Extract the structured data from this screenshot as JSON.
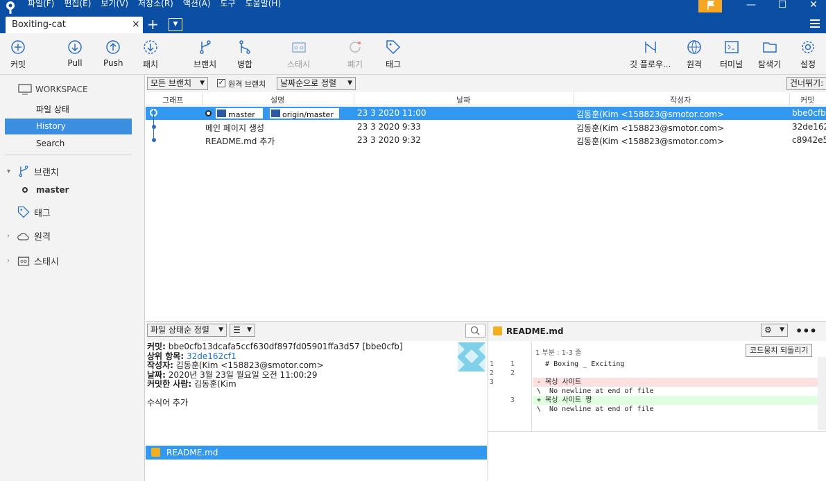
{
  "menu": [
    "파일(F)",
    "편집(E)",
    "보기(V)",
    "저장소(R)",
    "액션(A)",
    "도구",
    "도움말(H)"
  ],
  "tab": {
    "title": "Boxiting-cat",
    "close": "×",
    "plus": "+"
  },
  "toolbar": {
    "commit": "커밋",
    "pull": "Pull",
    "push": "Push",
    "fetch": "패치",
    "branch": "브랜치",
    "merge": "병합",
    "stash": "스태시",
    "discard": "폐기",
    "tag": "태그",
    "gitflow": "깃 플로우...",
    "remote": "원격",
    "terminal": "터미널",
    "explorer": "탐색기",
    "settings": "설정"
  },
  "sidebar": {
    "workspace": "WORKSPACE",
    "file_status": "파일 상태",
    "history": "History",
    "search": "Search",
    "branches": "브랜치",
    "branch_master": "master",
    "tags": "태그",
    "remotes": "원격",
    "stashes": "스태시"
  },
  "filters": {
    "all_branches": "모든 브랜치",
    "remote_branches": "원격 브랜치",
    "sort_date": "날짜순으로 정렬",
    "jump": "건너뛰기:"
  },
  "columns": {
    "graph": "그래프",
    "description": "설명",
    "date": "날짜",
    "author": "작성자",
    "commit": "커밋"
  },
  "commits": [
    {
      "desc": "",
      "date": "23 3 2020 11:00",
      "author": "김동훈(Kim <158823@smotor.com>",
      "hash": "bbe0cfb",
      "branch_local": "master",
      "branch_remote": "origin/master"
    },
    {
      "desc": "메인 페이지 생성",
      "date": "23 3 2020 9:33",
      "author": "김동훈(Kim <158823@smotor.com>",
      "hash": "32de162"
    },
    {
      "desc": "README.md 추가",
      "date": "23 3 2020 9:32",
      "author": "김동훈(Kim <158823@smotor.com>",
      "hash": "c8942e5"
    }
  ],
  "bottom_left": {
    "sort": "파일 상태순 정렬",
    "commit_label": "커밋:",
    "commit_value": "bbe0cfb13dcafa5ccf630df897fd05901ffa3d57 [bbe0cfb]",
    "parent_label": "상위 항목:",
    "parent_value": "32de162cf1",
    "author_label": "작성자:",
    "author_value": "김동훈(Kim <158823@smotor.com>",
    "date_label": "날짜:",
    "date_value": "2020년 3월 23일 월요일 오전 11:00:29",
    "committer_label": "커밋한 사람:",
    "committer_value": "김동훈(Kim",
    "message": "수식어 추가",
    "file": "README.md"
  },
  "diff": {
    "file": "README.md",
    "hunk": "1 부분 : 1-3 줄",
    "revert": "코드뭉치 되돌리기",
    "lines": [
      {
        "n1": "1",
        "n2": "1",
        "code": "  # Boxing _ Exciting",
        "type": "ctx"
      },
      {
        "n1": "2",
        "n2": "2",
        "code": "",
        "type": "ctx"
      },
      {
        "n1": "3",
        "n2": "",
        "code": "- 복싱 사이트",
        "type": "del"
      },
      {
        "n1": "",
        "n2": "",
        "code": "\\  No newline at end of file",
        "type": "ctx"
      },
      {
        "n1": "",
        "n2": "3",
        "code": "+ 복싱 사이트 짱",
        "type": "add"
      },
      {
        "n1": "",
        "n2": "",
        "code": "\\  No newline at end of file",
        "type": "ctx"
      }
    ]
  },
  "colors": {
    "titlebar": "#0a4fa3",
    "selected": "#3399f0",
    "sidebar_active": "#3c8fe0",
    "flag": "#f5a623"
  }
}
